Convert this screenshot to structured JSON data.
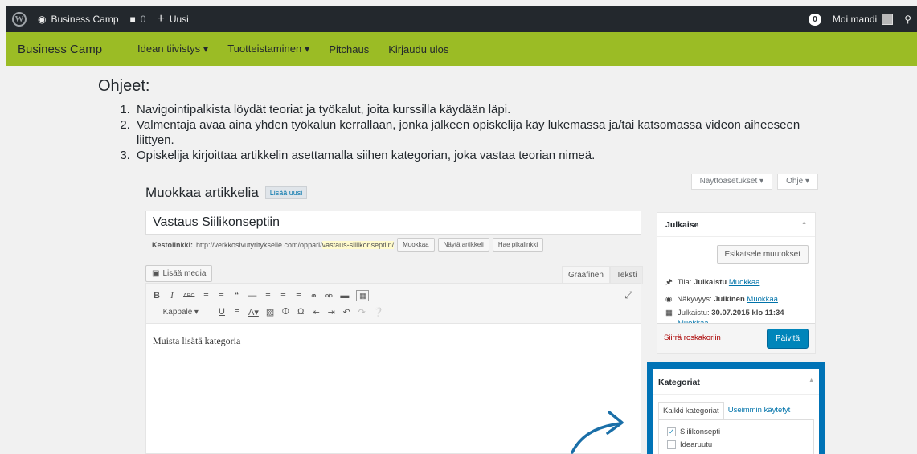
{
  "adminbar": {
    "site_name": "Business Camp",
    "comments_count": "0",
    "new_label": "Uusi",
    "notification_count": "0",
    "greeting": "Moi mandi"
  },
  "sitenav": {
    "brand": "Business Camp",
    "items": [
      {
        "label": "Idean tiivistys ▾"
      },
      {
        "label": "Tuotteistaminen ▾"
      },
      {
        "label": "Pitchaus"
      },
      {
        "label": "Kirjaudu ulos"
      }
    ]
  },
  "instructions": {
    "heading": "Ohjeet:",
    "steps": [
      "Navigointipalkista löydät teoriat ja työkalut, joita kurssilla käydään läpi.",
      "Valmentaja avaa aina yhden työkalun kerrallaan, jonka jälkeen opiskelija käy lukemassa ja/tai katsomassa videon aiheeseen liittyen.",
      "Opiskelija kirjoittaa artikkelin asettamalla siihen kategorian, joka vastaa teorian nimeä."
    ]
  },
  "editor": {
    "screen_options": "Näyttöasetukset ▾",
    "help": "Ohje ▾",
    "page_title": "Muokkaa artikkelia",
    "add_new": "Lisää uusi",
    "post_title": "Vastaus Siilikonseptiin",
    "permalink_label": "Kestolinkki:",
    "permalink_base": "http://verkkosivutyritykselle.com/oppari/",
    "permalink_slug": "vastaus-siilikonseptiin/",
    "btn_edit": "Muokkaa",
    "btn_view": "Näytä artikkeli",
    "btn_shortlink": "Hae pikalinkki",
    "add_media": "Lisää media",
    "tab_visual": "Graafinen",
    "tab_text": "Teksti",
    "format_select": "Kappale",
    "content": "Muista lisätä kategoria"
  },
  "publish": {
    "title": "Julkaise",
    "preview": "Esikatsele muutokset",
    "status_label": "Tila:",
    "status_value": "Julkaistu",
    "visibility_label": "Näkyvyys:",
    "visibility_value": "Julkinen",
    "published_label": "Julkaistu:",
    "published_value": "30.07.2015 klo 11:34",
    "edit_link": "Muokkaa",
    "trash": "Siirrä roskakoriin",
    "update": "Päivitä"
  },
  "categories": {
    "title": "Kategoriat",
    "tab_all": "Kaikki kategoriat",
    "tab_popular": "Useimmin käytetyt",
    "items": [
      {
        "label": "Siilikonsepti",
        "checked": true
      },
      {
        "label": "Idearuutu",
        "checked": false
      }
    ]
  },
  "colors": {
    "adminbar": "#23282d",
    "nav_green": "#9bbc25",
    "highlight_blue": "#0073b6",
    "button_blue": "#0085ba"
  }
}
